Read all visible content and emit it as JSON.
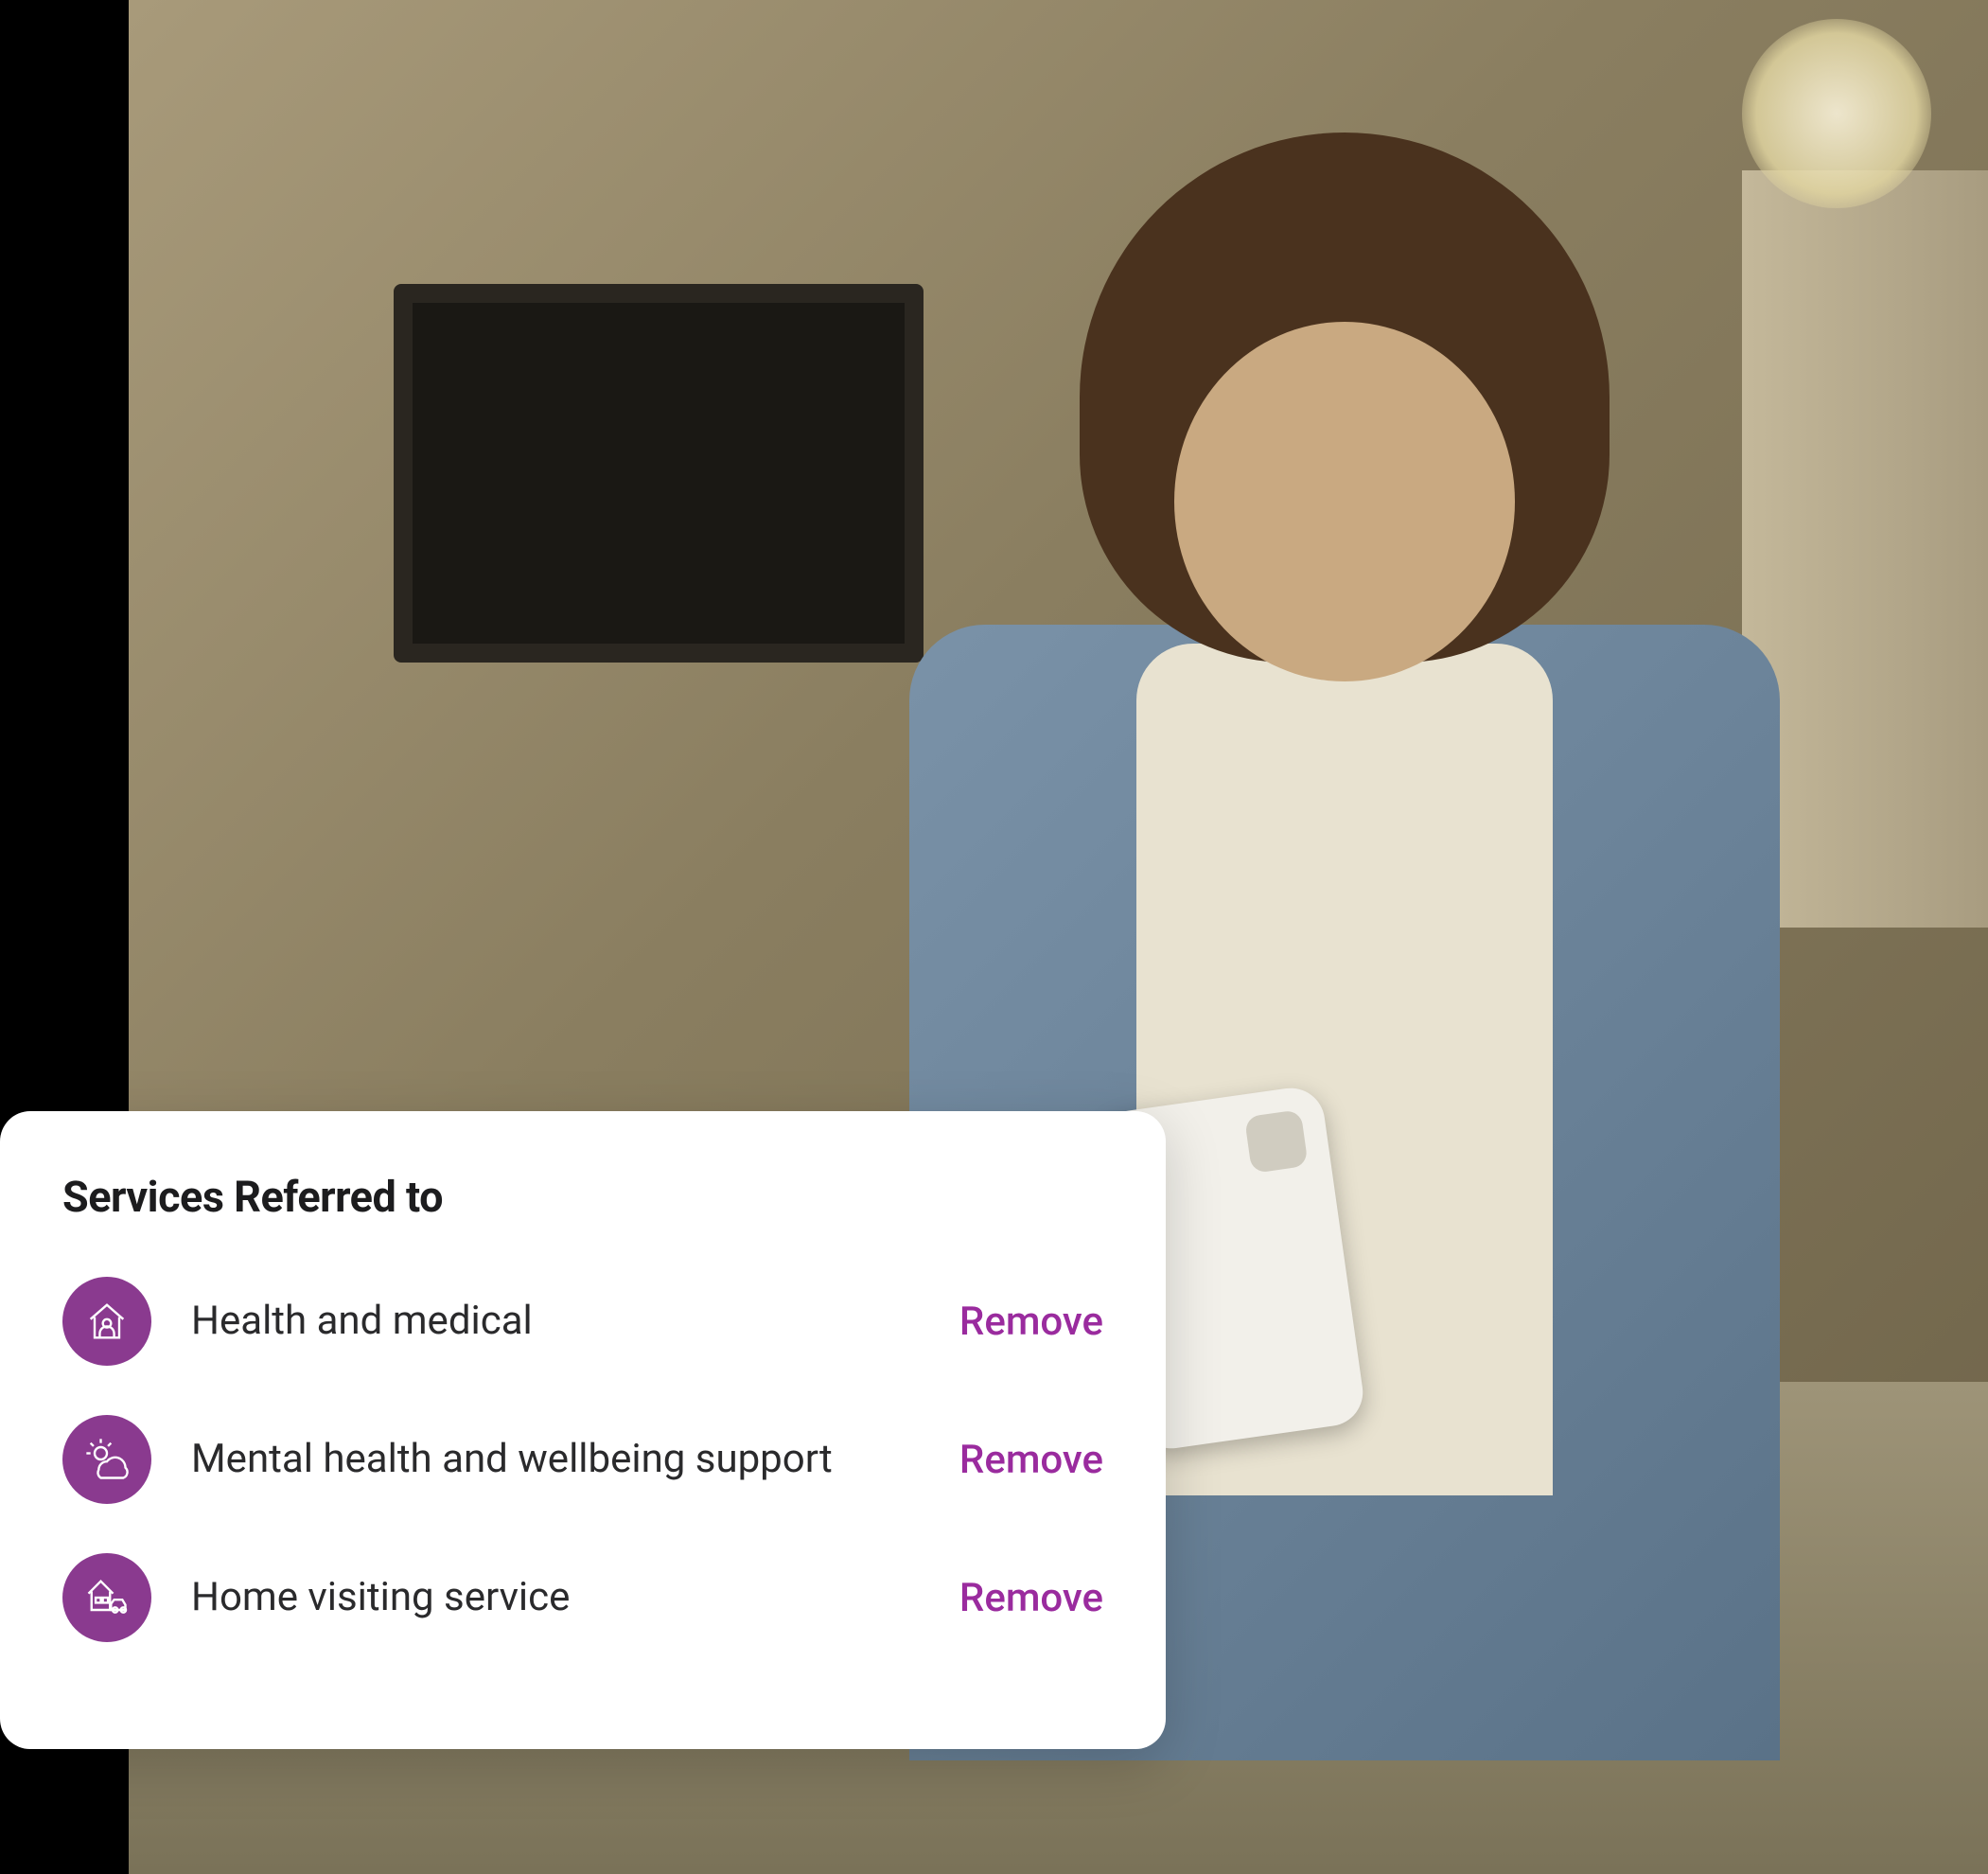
{
  "card": {
    "title": "Services Referred to",
    "services": [
      {
        "label": "Health and medical",
        "action": "Remove",
        "icon": "house-person-icon"
      },
      {
        "label": "Mental health and wellbeing support",
        "action": "Remove",
        "icon": "sun-cloud-icon"
      },
      {
        "label": "Home visiting service",
        "action": "Remove",
        "icon": "house-car-icon"
      }
    ]
  },
  "colors": {
    "accent": "#8a3a8f",
    "link": "#9a2b9e",
    "text": "#2a2a2c",
    "title": "#1c1c1e",
    "card_bg": "#ffffff"
  }
}
